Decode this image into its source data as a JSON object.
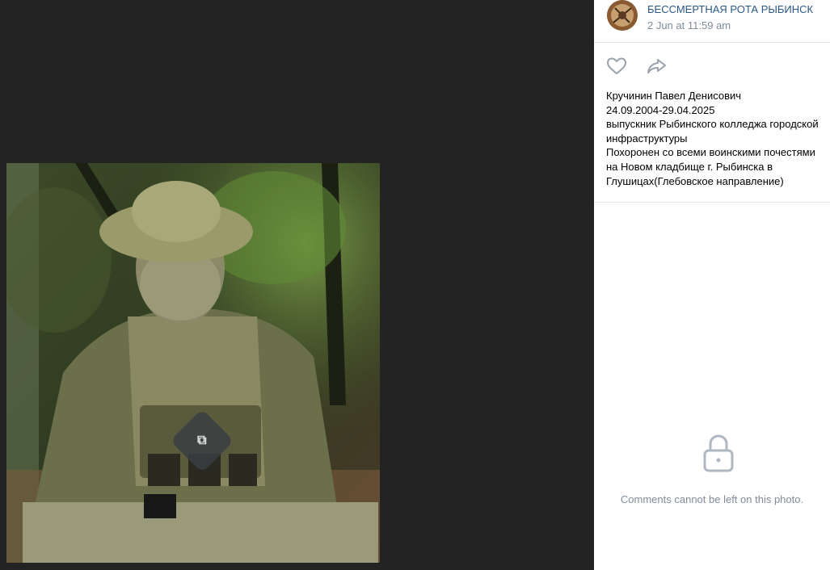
{
  "post": {
    "author": "БЕССМЕРТНАЯ РОТА РЫБИНСК",
    "date": "2 Jun at 11:59 am",
    "text_lines": [
      "Кручинин Павел Денисович",
      "24.09.2004-29.04.2025",
      "выпускник Рыбинского колледжа городской",
      "инфраструктуры",
      "Похоронен со всеми воинскими почестями",
      "на Новом кладбище г. Рыбинска в",
      "Глушицах(Глебовское направление)"
    ]
  },
  "actions": {
    "like_icon": "heart-icon",
    "share_icon": "share-arrow-icon"
  },
  "comments": {
    "lock_icon": "lock-icon",
    "message": "Comments cannot be left on this photo."
  },
  "photo": {
    "subject": "soldier in camouflage in forest",
    "watermark_icon": "bookmark-icon"
  }
}
